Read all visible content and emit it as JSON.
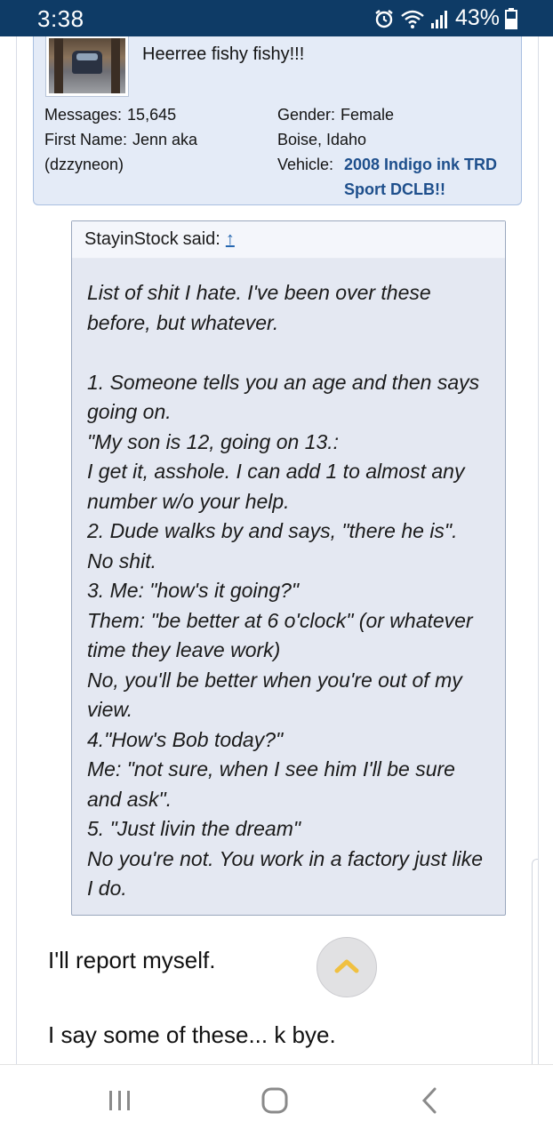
{
  "status_bar": {
    "time": "3:38",
    "battery": "43%",
    "icons": [
      "alarm-icon",
      "wifi-icon",
      "signal-icon",
      "battery-icon"
    ]
  },
  "profile": {
    "signature": "Heerree fishy fishy!!!",
    "messages_label": "Messages:",
    "messages_value": "15,645",
    "first_name_label": "First Name:",
    "first_name_value": "Jenn aka",
    "first_name_cont": "(dzzyneon)",
    "gender_label": "Gender:",
    "gender_value": "Female",
    "location": "Boise, Idaho",
    "vehicle_label": "Vehicle:",
    "vehicle_value": "2008 Indigo ink TRD Sport DCLB!!"
  },
  "quote": {
    "author": "StayinStock",
    "said": "said:",
    "jump_icon": "↑",
    "lines": [
      "List of shit I hate. I've been over these",
      "before, but whatever.",
      " ",
      "1. Someone tells you an age and then says",
      "going on.",
      "\"My son is 12, going on 13.:",
      "I get it, asshole. I can add 1 to almost any",
      "number w/o your help.",
      "2. Dude walks by and says, \"there he is\".",
      "No shit.",
      "3. Me: \"how's it going?\"",
      "Them: \"be better at 6 o'clock\" (or whatever",
      "time they leave work)",
      "No, you'll be better when you're out of my",
      "view.",
      "4.\"How's Bob today?\"",
      "Me: \"not sure, when I see him I'll be sure",
      "and ask\".",
      "5. \"Just livin the dream\"",
      "No you're not. You work in a factory just like",
      "I do."
    ]
  },
  "post": {
    "line1": "I'll report myself.",
    "line2": "I say some of these... k bye."
  },
  "colors": {
    "status_bar_bg": "#0e3b66",
    "profile_bg": "#e4ebf7",
    "vehicle_link": "#1e4f8c",
    "quote_bg": "#e4e8f2",
    "scroll_arrow": "#f0c040"
  },
  "nav": {
    "recents_icon": "recents-icon",
    "home_icon": "home-icon",
    "back_icon": "back-icon"
  }
}
